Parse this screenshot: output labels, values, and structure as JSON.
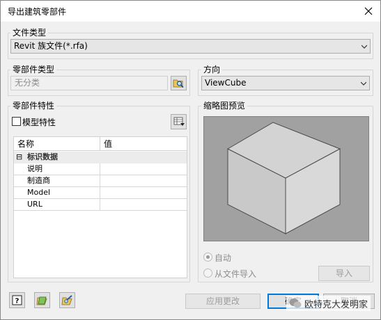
{
  "title": "导出建筑零部件",
  "file_type": {
    "label": "文件类型",
    "value": "Revit 族文件(*.rfa)"
  },
  "part_type": {
    "label": "零部件类型",
    "value": "无分类"
  },
  "direction": {
    "label": "方向",
    "value": "ViewCube"
  },
  "part_props": {
    "label": "零部件特性",
    "model_props_label": "模型特性",
    "model_props_checked": false,
    "headers": [
      "名称",
      "值"
    ],
    "category": "标识数据",
    "category_toggle": "⊟",
    "rows": [
      {
        "name": "说明",
        "value": ""
      },
      {
        "name": "制造商",
        "value": ""
      },
      {
        "name": "Model",
        "value": ""
      },
      {
        "name": "URL",
        "value": ""
      }
    ]
  },
  "thumbnail": {
    "label": "缩略图预览",
    "option_auto": "自动",
    "option_auto_checked": true,
    "option_file": "从文件导入",
    "import_button": "导入"
  },
  "footer": {
    "apply": "应用更改",
    "ok": "确定",
    "cancel": "取消"
  },
  "watermark": "欧特克大发明家"
}
